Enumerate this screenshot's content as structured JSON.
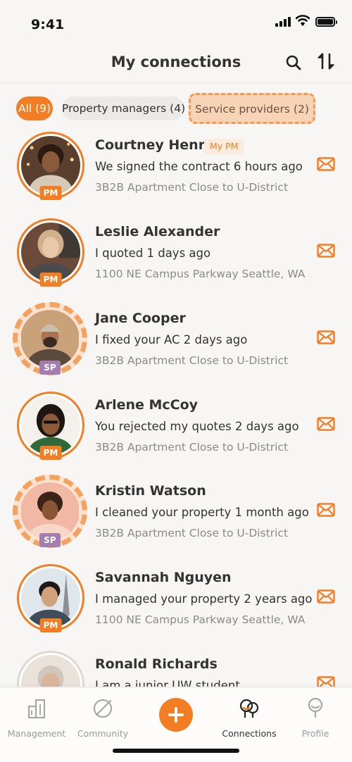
{
  "status": {
    "time": "9:41"
  },
  "header": {
    "title": "My connections"
  },
  "filters": {
    "all": "All (9)",
    "property_managers": "Property managers (4)",
    "service_providers": "Service providers (2)"
  },
  "connections": [
    {
      "name": "Courtney Henry",
      "badge": "My PM",
      "message": "We signed the contract 6 hours ago",
      "address": "3B2B Apartment Close to U-District",
      "role": "PM"
    },
    {
      "name": "Leslie Alexander",
      "message": "I quoted 1 days ago",
      "address": "1100 NE Campus Parkway Seattle, WA",
      "role": "PM"
    },
    {
      "name": "Jane Cooper",
      "message": "I fixed your AC 2 days ago",
      "address": "3B2B Apartment Close to U-District",
      "role": "SP"
    },
    {
      "name": "Arlene McCoy",
      "message": "You rejected my quotes 2 days ago",
      "address": "3B2B Apartment Close to U-District",
      "role": "PM"
    },
    {
      "name": "Kristin Watson",
      "message": "I cleaned your property 1 month ago",
      "address": "3B2B Apartment Close to U-District",
      "role": "SP"
    },
    {
      "name": "Savannah Nguyen",
      "message": "I managed your property 2 years ago",
      "address": "1100 NE Campus Parkway Seattle, WA",
      "role": "PM"
    },
    {
      "name": "Ronald Richards",
      "message": "I am a junior UW student"
    }
  ],
  "nav": {
    "management": "Management",
    "community": "Community",
    "connections": "Connections",
    "profile": "Profile"
  },
  "colors": {
    "accent": "#f27d22",
    "sp_badge": "#a27dae",
    "background": "#f8f6f4"
  }
}
